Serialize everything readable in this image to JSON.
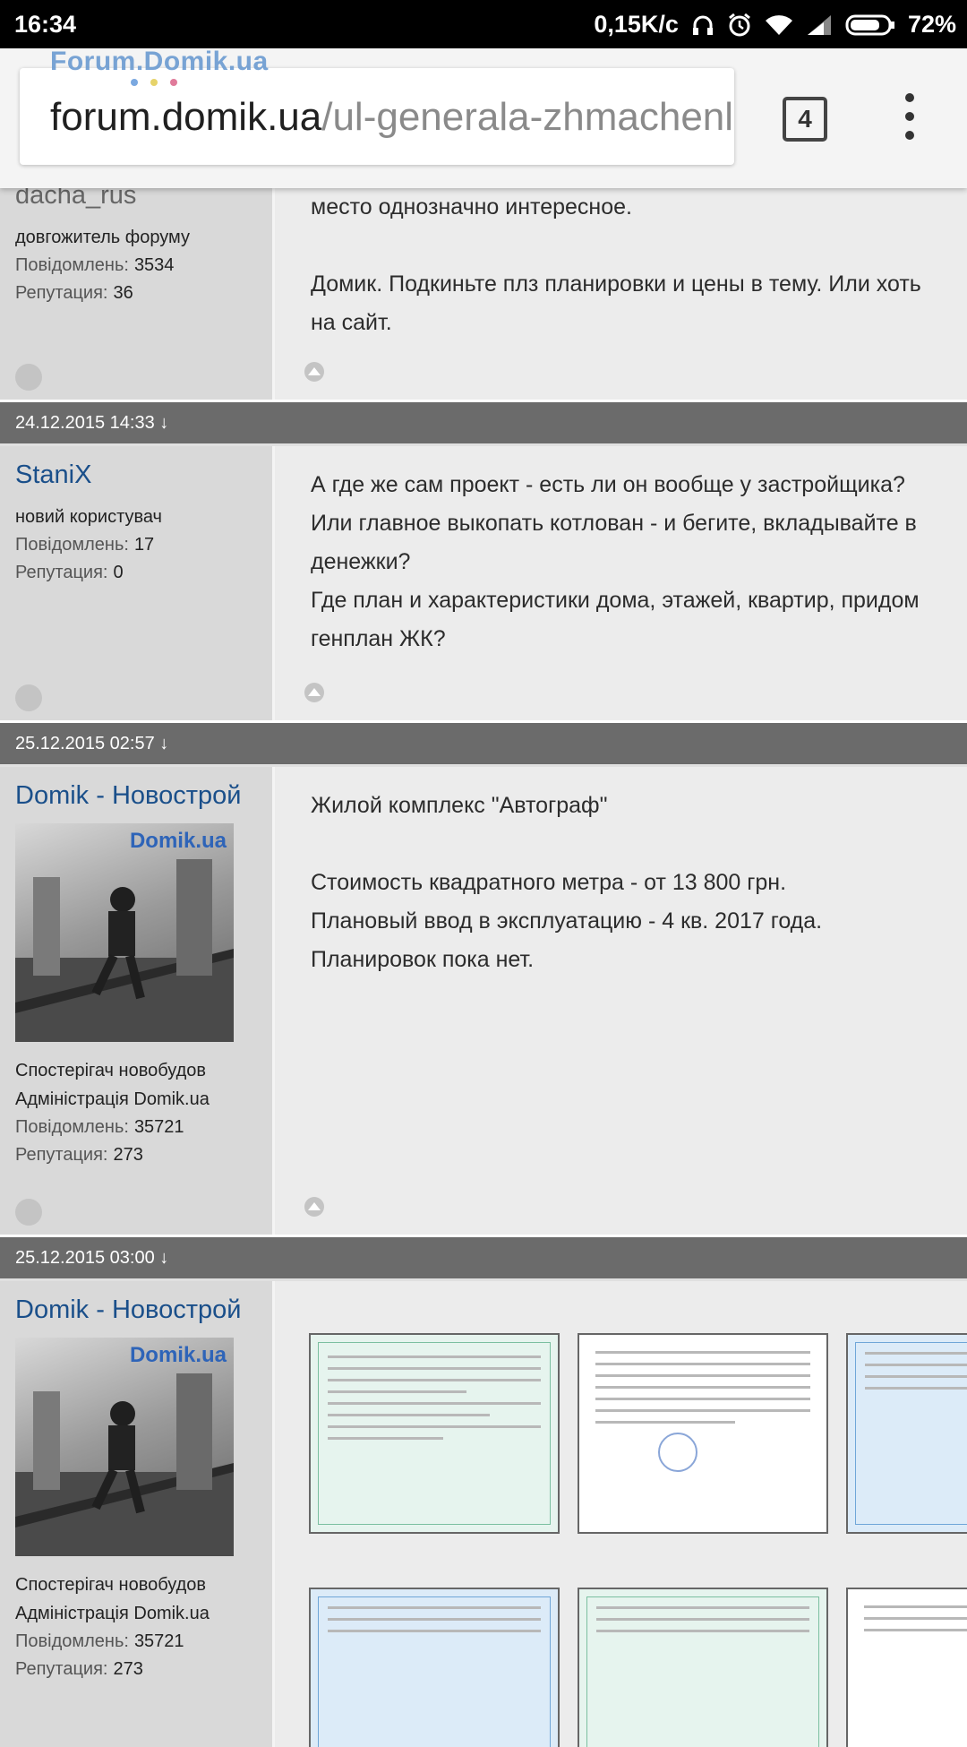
{
  "status_bar": {
    "time": "16:34",
    "speed": "0,15K/c",
    "battery": "72%"
  },
  "browser": {
    "url_domain": "forum.domik.ua",
    "url_path": "/ul-generala-zhmachenko",
    "tab_count": "4",
    "site_logo": "Forum.Domik.ua"
  },
  "posts": [
    {
      "username": "dacha_rus",
      "rank": "довгожитель форуму",
      "messages_label": "Повідомлень:",
      "messages": "3534",
      "reputation_label": "Репутация:",
      "reputation": "36",
      "text": [
        "место однозначно интересное.",
        "Домик. Подкиньте плз планировки и цены в тему. Или хоть",
        "на сайт."
      ]
    },
    {
      "date": "24.12.2015 14:33 ↓",
      "username": "StaniX",
      "rank": "новий користувач",
      "messages_label": "Повідомлень:",
      "messages": "17",
      "reputation_label": "Репутация:",
      "reputation": "0",
      "text": [
        "А где же сам проект - есть ли он вообще у застройщика?",
        "Или главное выкопать котлован - и бегите, вкладывайте в",
        "денежки?",
        "Где план и характеристики дома, этажей, квартир, придом",
        "генплан ЖК?"
      ]
    },
    {
      "date": "25.12.2015 02:57 ↓",
      "username": "Domik - Новострой",
      "avatar_brand": "Domik.ua",
      "rank_line1": "Спостерігач новобудов",
      "rank_line2": "Адміністрація Domik.ua",
      "messages_label": "Повідомлень:",
      "messages": "35721",
      "reputation_label": "Репутация:",
      "reputation": "273",
      "text": [
        "Жилой комплекс \"Автограф\"",
        "Стоимость квадратного метра - от 13 800 грн.",
        "Плановый ввод в эксплуатацию - 4 кв. 2017 года.",
        "Планировок пока нет."
      ]
    },
    {
      "date": "25.12.2015 03:00 ↓",
      "username": "Domik - Новострой",
      "avatar_brand": "Domik.ua",
      "rank_line1": "Спостерігач новобудов",
      "rank_line2": "Адміністрація Domik.ua",
      "messages_label": "Повідомлень:",
      "messages": "35721",
      "reputation_label": "Репутация:",
      "reputation": "273"
    }
  ],
  "colors": {
    "link_blue": "#1a4f8a",
    "date_bar": "#6b6b6b",
    "sidebar_bg": "#d9d9d9",
    "post_bg": "#ececec"
  }
}
